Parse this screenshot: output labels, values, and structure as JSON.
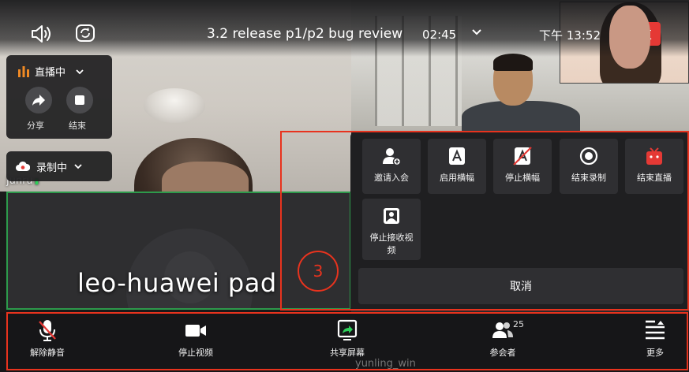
{
  "topbar": {
    "title": "3.2 release p1/p2 bug review",
    "duration": "02:45",
    "clock": "下午 13:52",
    "end_label": "结束"
  },
  "live_panel": {
    "status": "直播中",
    "share_label": "分享",
    "stop_label": "结束"
  },
  "record_panel": {
    "status": "录制中"
  },
  "tiles": {
    "top_left_name": "junru",
    "main_name": "leo-huawei pad",
    "bottom_name": "yunling_win"
  },
  "more_menu": {
    "items": [
      {
        "label": "邀请入会",
        "icon": "invite-icon"
      },
      {
        "label": "启用横幅",
        "icon": "banner-on-icon"
      },
      {
        "label": "停止横幅",
        "icon": "banner-off-icon"
      },
      {
        "label": "结束录制",
        "icon": "stop-record-icon"
      },
      {
        "label": "结束直播",
        "icon": "end-live-icon"
      },
      {
        "label": "停止接收视频",
        "icon": "stop-receive-video-icon"
      }
    ],
    "cancel_label": "取消"
  },
  "annotation": {
    "step_number": "3",
    "color": "#e8331e"
  },
  "toolbar": {
    "items": [
      {
        "label": "解除静音",
        "icon": "mic-muted-icon"
      },
      {
        "label": "停止视频",
        "icon": "video-camera-icon"
      },
      {
        "label": "共享屏幕",
        "icon": "share-screen-icon"
      },
      {
        "label": "参会者",
        "icon": "participants-icon",
        "count": "25"
      },
      {
        "label": "更多",
        "icon": "more-menu-icon"
      }
    ]
  },
  "colors": {
    "danger": "#e53935",
    "active_speaker_border": "#2d9a4b",
    "live_orange": "#f08a24"
  }
}
